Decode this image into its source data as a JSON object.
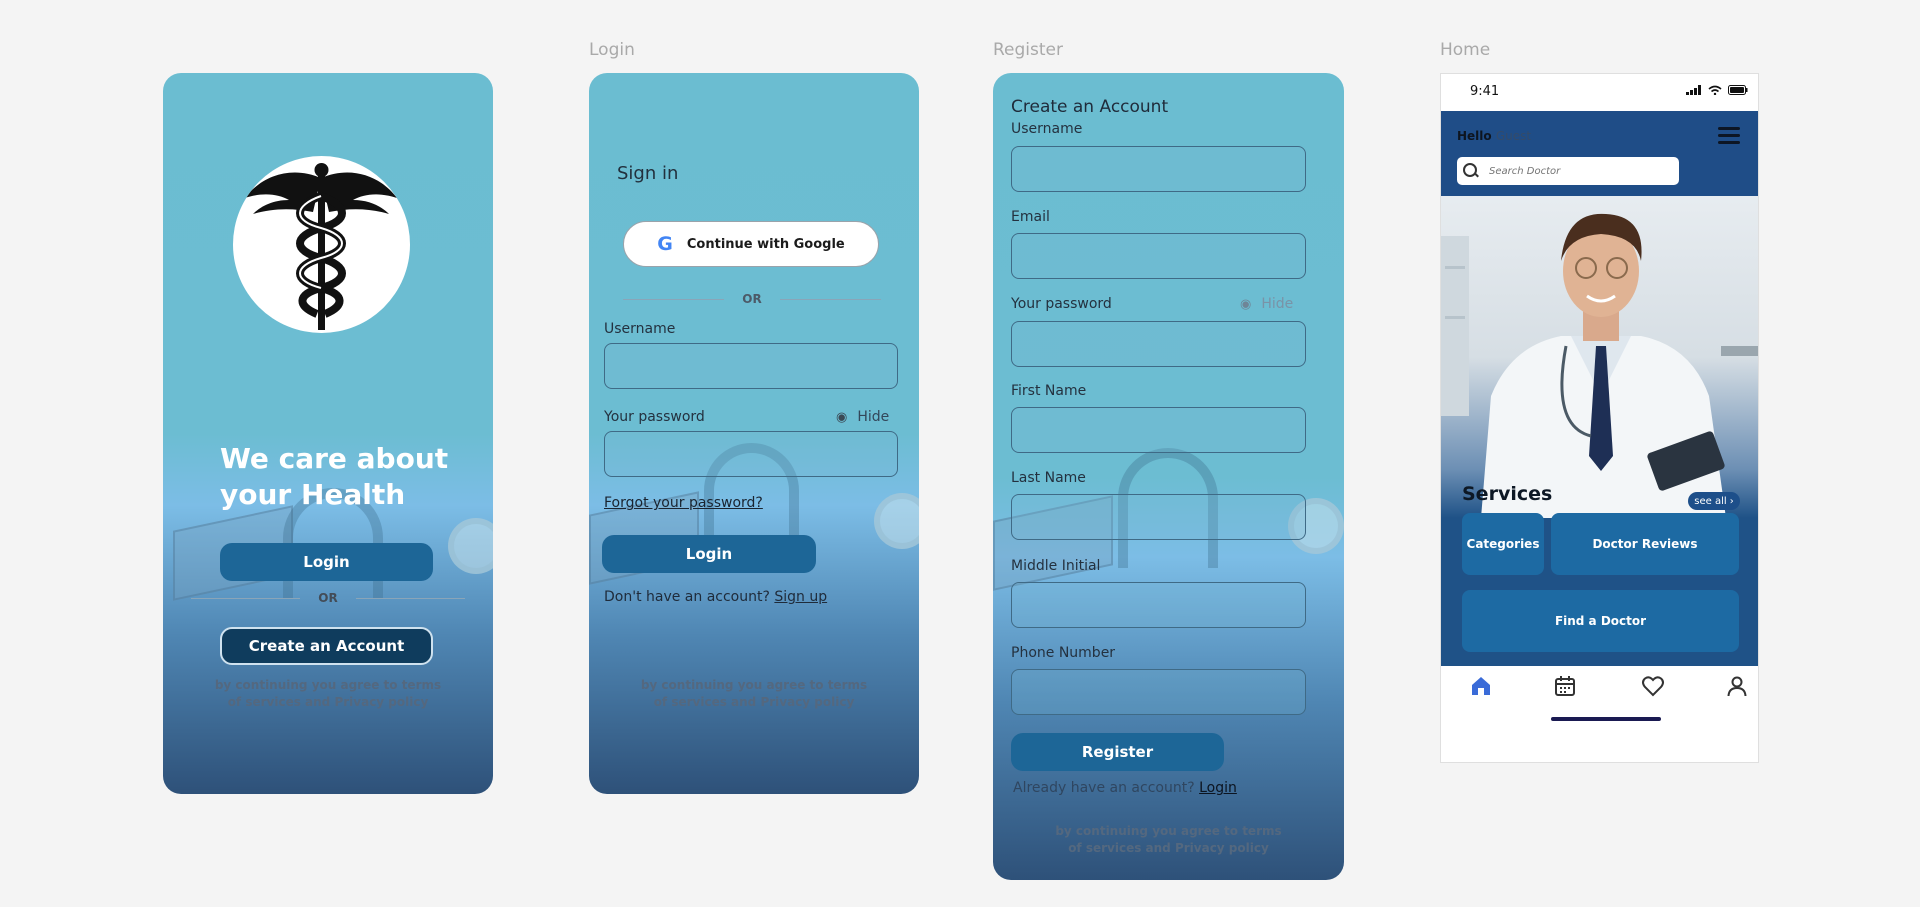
{
  "frames": {
    "login": "Login",
    "register": "Register",
    "home": "Home"
  },
  "splash": {
    "headline_line1": "We care about",
    "headline_line2": "your Health",
    "login_button": "Login",
    "or": "OR",
    "create_account_button": "Create an Account",
    "legal_line1": "by continuing you agree to terms",
    "legal_line2": "of services and  Privacy policy"
  },
  "login": {
    "title": "Sign in",
    "google_button": "Continue with Google",
    "or": "OR",
    "username_label": "Username",
    "password_label": "Your password",
    "hide_label": "Hide",
    "forgot": "Forgot your password?",
    "login_button": "Login",
    "no_account": "Don't have an account?",
    "signup_link": "Sign up",
    "legal_line1": "by continuing you agree to terms",
    "legal_line2": "of services and  Privacy policy"
  },
  "register": {
    "title": "Create an Account",
    "username_label": "Username",
    "email_label": "Email",
    "password_label": "Your password",
    "hide_label": "Hide",
    "first_name_label": "First Name",
    "last_name_label": "Last Name",
    "middle_initial_label": "Middle Initial",
    "phone_label": "Phone Number",
    "register_button": "Register",
    "have_account": "Already have an account?",
    "login_link": "Login",
    "legal_line1": "by continuing you agree to terms",
    "legal_line2": "of services and  Privacy policy"
  },
  "home": {
    "time": "9:41",
    "hello": "Hello",
    "guest": "Guest",
    "search_placeholder": "Search Doctor",
    "services_title": "Services",
    "see_all": "see all",
    "categories": "Categories",
    "doctor_reviews": "Doctor Reviews",
    "find_doctor": "Find a Doctor",
    "tabs": [
      "home-icon",
      "calendar-icon",
      "heart-icon",
      "profile-icon"
    ],
    "colors": {
      "primary": "#1d6697",
      "header": "#1f4d87",
      "active_tab": "#3a6bd8"
    }
  }
}
